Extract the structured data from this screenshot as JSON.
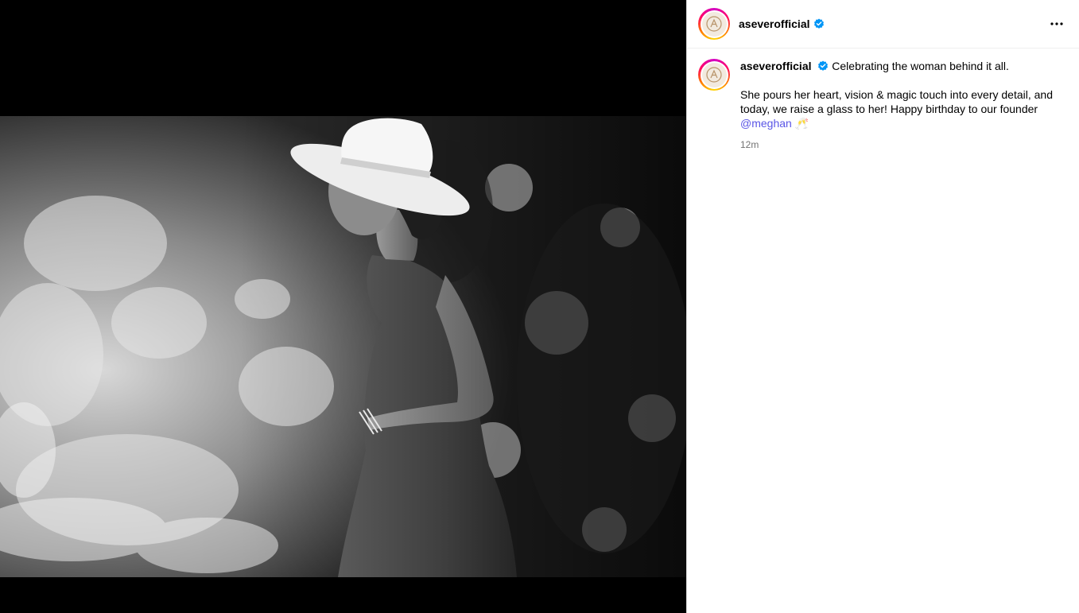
{
  "post": {
    "username": "aseverofficial",
    "verified_icon": "verified-badge-icon",
    "more_icon": "more-options-icon",
    "caption": {
      "username": "aseverofficial",
      "headline": "Celebrating the woman behind it all.",
      "body": "She pours her heart, vision & magic touch into every detail, and today, we raise a glass to her! Happy birthday to our founder",
      "mention": "@meghan",
      "emoji": "🥂"
    },
    "timestamp": "12m"
  },
  "colors": {
    "verified_blue": "#0095f6",
    "mention": "#5a55e6",
    "timestamp": "#737373",
    "divider": "#efefef"
  }
}
